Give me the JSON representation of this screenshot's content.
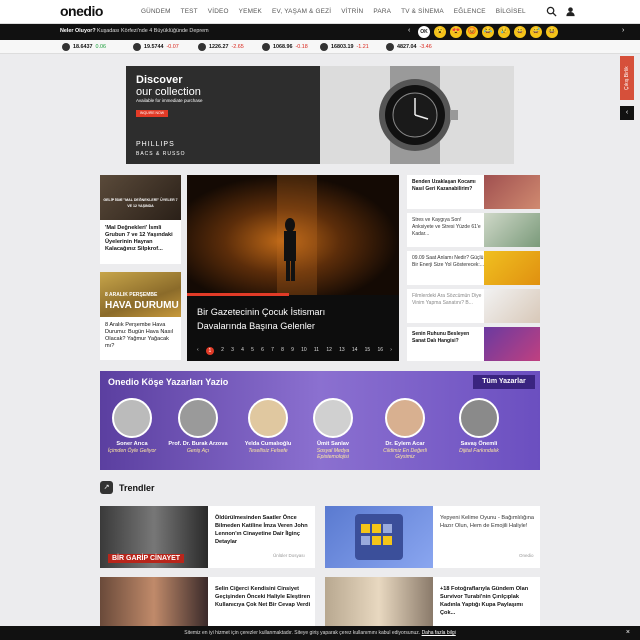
{
  "header": {
    "logo": "onedio",
    "nav": [
      "GÜNDEM",
      "TEST",
      "VİDEO",
      "YEMEK",
      "EV, YAŞAM & GEZİ",
      "VİTRİN",
      "PARA",
      "TV & SİNEMA",
      "EĞLENCE",
      "BİLGİSEL"
    ]
  },
  "ticker": {
    "label": "Neler Oluyor?",
    "headline": "Kuşadası Körfezi'nde 4 Büyüklüğünde Deprem",
    "reactions": [
      "OK",
      "😮",
      "😍",
      "😡",
      "😂",
      "😢",
      "😀",
      "😅",
      "😆"
    ]
  },
  "markets": [
    {
      "icon": "$",
      "value": "18.6437",
      "change": "0.06",
      "color": "#1a9e3a"
    },
    {
      "icon": "€",
      "value": "19.5744",
      "change": "-0.07",
      "color": "#d9251b"
    },
    {
      "icon": "Au",
      "value": "1226.27",
      "change": "-2.65",
      "color": "#d9251b"
    },
    {
      "icon": "£",
      "value": "1068.96",
      "change": "-0.18",
      "color": "#d9251b"
    },
    {
      "icon": "B",
      "value": "16803.19",
      "change": "-1.21",
      "color": "#d9251b"
    },
    {
      "icon": "↗",
      "value": "4827.04",
      "change": "-3.46",
      "color": "#d9251b"
    }
  ],
  "ad": {
    "headline_1": "Discover",
    "headline_2": "our collection",
    "sub": "Available for immediate purchase",
    "button": "INQUIRE NOW",
    "brand_1": "PHILLIPS",
    "brand_2": "BACS & RUSSO"
  },
  "side": {
    "tab": "Çıkış Birlik"
  },
  "left_cards": [
    {
      "overlay": "GELİP İSMİ \"MAL DEĞNEKLERİ\" ÜYELER 7 VE 12 YAŞINDA",
      "title": "'Mal Değnekleri' İsmli Grubun 7 ve 12 Yaşındaki Üyelerinin Hayran Kalacağınız Silpkrof..."
    },
    {
      "overlay_1": "8 ARALIK PERŞEMBE",
      "overlay_2": "HAVA DURUMU",
      "title": "8 Aralık Perşembe Hava Durumu: Bugün Hava Nasıl Olacak? Yağmur Yağacak mı?"
    }
  ],
  "hero": {
    "title": "Bir Gazetecinin Çocuk İstismarı Davalarında Başına Gelenler",
    "pages": [
      "1",
      "2",
      "3",
      "4",
      "5",
      "6",
      "7",
      "8",
      "9",
      "10",
      "11",
      "12",
      "13",
      "14",
      "15",
      "16"
    ],
    "active": "1"
  },
  "right_list": [
    {
      "title": "Benden Uzaklaşan Kocamı Nasıl Geri Kazanabilirim?"
    },
    {
      "title": "Stres ve Kaygıya Son! Anksiyete ve Stresi Yüzde 61'e Kadar..."
    },
    {
      "title": "09.09 Saat Anlamı Nedir? Güçlü Bir Enerji Size Yol Gösterecek:..."
    },
    {
      "title": "Filmlerdeki Ara Sözcümün Diye Vinim Yapma Sanatını? B..."
    },
    {
      "title": "Senin Ruhunu Besleyen Sanat Dalı Hangisi?"
    }
  ],
  "writers": {
    "title": "Onedio Köşe Yazarları Yazio",
    "button": "Tüm Yazarlar",
    "list": [
      {
        "name": "Soner Arıca",
        "sub": "İçimden Öyle Geliyor"
      },
      {
        "name": "Prof. Dr. Burak Arzova",
        "sub": "Geniş Açı"
      },
      {
        "name": "Yelda Cumalıoğlu",
        "sub": "Tesellisiz Felsefe"
      },
      {
        "name": "Ümit Sanlav",
        "sub": "Sosyal Medya Epistemolojisi"
      },
      {
        "name": "Dr. Eylem Acar",
        "sub": "Cildimiz En Değerli Giysimiz"
      },
      {
        "name": "Savaş Önemli",
        "sub": "Dijital Farkındalık"
      }
    ]
  },
  "trends": {
    "label": "Trendler",
    "cards": [
      {
        "title": "Öldürülmesinden Saatler Önce Bilmeden Katiline İmza Veren John Lennon'ın Cinayetine Dair İlginç Detaylar",
        "src": "Ünlüler Dosyası",
        "img_label": "BİR GARİP CİNAYET"
      },
      {
        "title": "Yepyeni Kelime Oyunu - Bağımlılığına Hazır Olun, Hem de Emojili Haliyle!",
        "src": "Onedio"
      },
      {
        "title": "Selin Ciğerci Kendisini Cinsiyet Geçişinden Önceki Haliyle Eleştiren Kullanıcıya Çok Net Bir Cevap Verdi",
        "src": ""
      },
      {
        "title": "+18 Fotoğraflarıyla Gündem Olan Survivor Turabi'nin Çırılçıplak Kadınla Yaptığı Kupa Paylaşımı Çok...",
        "src": ""
      }
    ]
  },
  "cookie": {
    "text": "Sitemiz en iyi hizmet için çerezler kullanmaktadır. Siteye giriş yaparak çerez kullanımını kabul ediyorsunuz.",
    "link": "Daha fazla bilgi",
    "close": "×"
  }
}
